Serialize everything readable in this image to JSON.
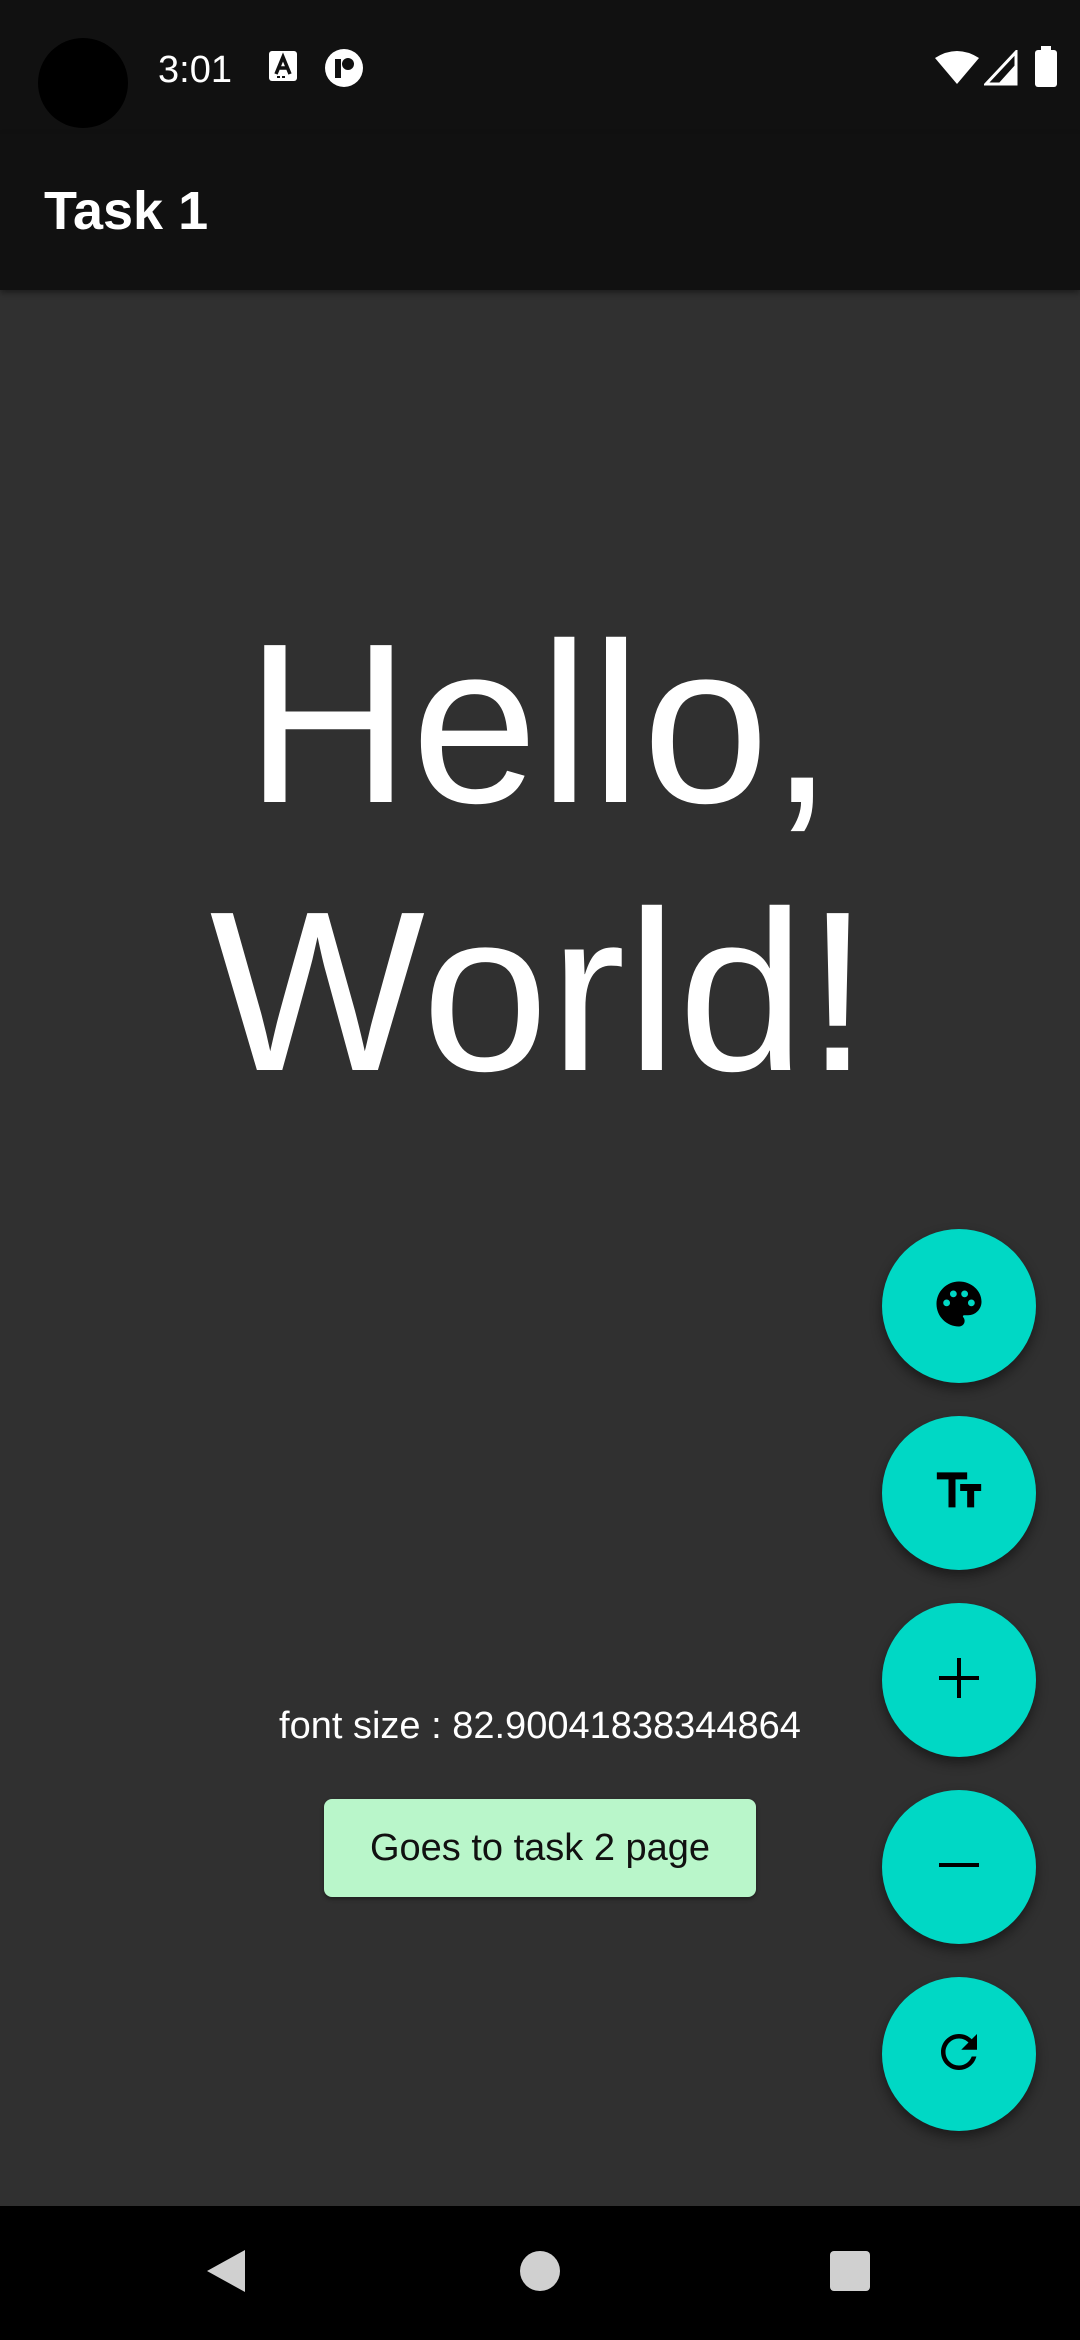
{
  "status_bar": {
    "time": "3:01",
    "icons": [
      "font-notification-icon",
      "app-notification-icon",
      "wifi-icon",
      "cellular-signal-icon",
      "battery-icon"
    ]
  },
  "app_bar": {
    "title": "Task 1"
  },
  "main": {
    "greeting_line1": "Hello,",
    "greeting_line2": "World!",
    "font_size_label": "font size : 82.90041838344864",
    "task2_button_label": "Goes to task 2 page"
  },
  "fabs": [
    {
      "name": "palette-fab",
      "icon": "palette-icon"
    },
    {
      "name": "text-size-fab",
      "icon": "text-fields-icon"
    },
    {
      "name": "increase-font-fab",
      "icon": "plus-icon"
    },
    {
      "name": "decrease-font-fab",
      "icon": "minus-icon"
    },
    {
      "name": "reset-fab",
      "icon": "refresh-icon"
    }
  ],
  "nav_bar": {
    "buttons": [
      "back-icon",
      "home-icon",
      "recents-icon"
    ]
  },
  "colors": {
    "background": "#303030",
    "app_bar": "#111111",
    "fab": "#00d8c5",
    "button": "#b9f6ca"
  }
}
